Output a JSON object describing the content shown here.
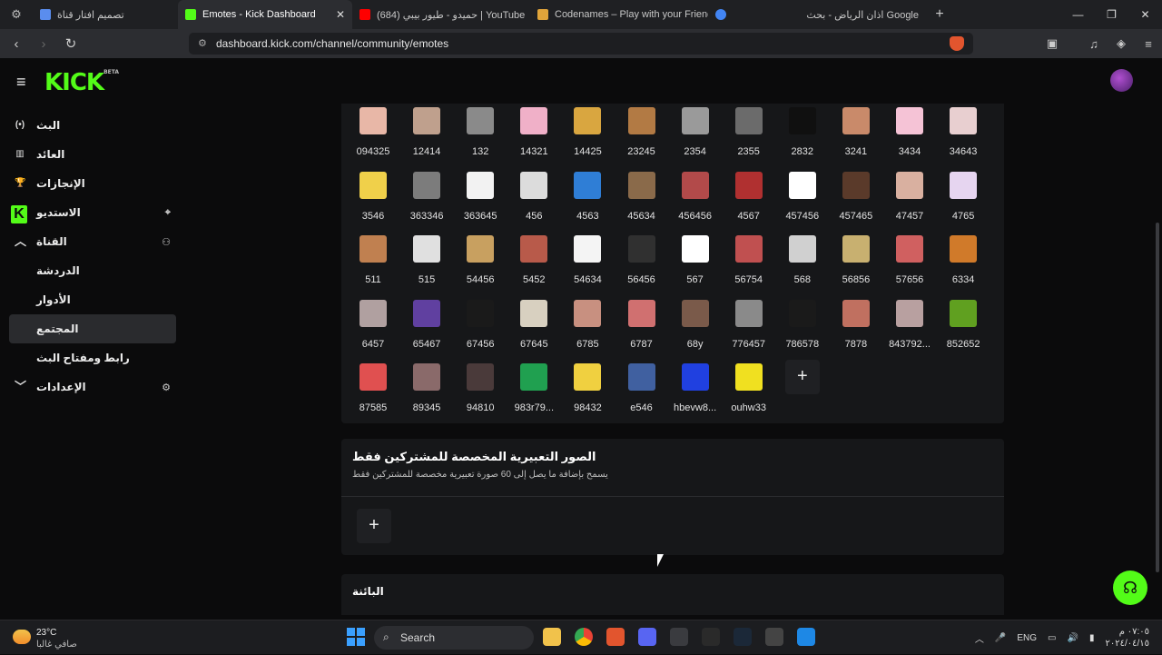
{
  "browser": {
    "tabs": [
      {
        "title": "تصميم افتار قناة",
        "color": "#5a8dee"
      },
      {
        "title": "Emotes - Kick Dashboard",
        "color": "#53fc18",
        "active": true
      },
      {
        "title": "حميدو - طيور بيبي (684) | YouTube",
        "color": "#ff0000"
      },
      {
        "title": "Codenames – Play with your Friends",
        "color": "#e0a43a"
      },
      {
        "title": "",
        "color": "#4285f4"
      },
      {
        "title": "اذان الرياض - بحث Google",
        "color": "#4285f4"
      }
    ],
    "url": "dashboard.kick.com/channel/community/emotes"
  },
  "app": {
    "logo": "KICK",
    "logo_badge": "BETA"
  },
  "sidebar": {
    "items": [
      {
        "label": "البث",
        "icon": "broadcast-icon"
      },
      {
        "label": "العائد",
        "icon": "chart-icon"
      },
      {
        "label": "الإنجازات",
        "icon": "trophy-icon"
      },
      {
        "label": "الاستديو",
        "icon": "studio-icon"
      },
      {
        "label": "القناة",
        "icon": "channel-icon"
      },
      {
        "label": "الدردشة"
      },
      {
        "label": "الأدوار"
      },
      {
        "label": "المجتمع"
      },
      {
        "label": "رابط ومفتاح البث"
      },
      {
        "label": "الإعدادات",
        "icon": "settings-icon"
      }
    ]
  },
  "emotes": {
    "row1": [
      "094325",
      "12414",
      "132",
      "14321",
      "14425",
      "23245",
      "2354",
      "2355",
      "2832",
      "3241",
      "3434",
      "34643"
    ],
    "row2": [
      "3546",
      "363346",
      "363645",
      "456",
      "4563",
      "45634",
      "456456",
      "4567",
      "457456",
      "457465",
      "47457",
      "4765"
    ],
    "row3": [
      "511",
      "515",
      "54456",
      "5452",
      "54634",
      "56456",
      "567",
      "56754",
      "568",
      "56856",
      "57656",
      "6334"
    ],
    "row4": [
      "6457",
      "65467",
      "67456",
      "67645",
      "6785",
      "6787",
      "68y",
      "776457",
      "786578",
      "7878",
      "843792...",
      "852652"
    ],
    "row5": [
      "87585",
      "89345",
      "94810",
      "983r79...",
      "98432",
      "e546",
      "hbevw8...",
      "ouhw33"
    ],
    "thumb_colors": [
      "#e8b7a7",
      "#bfa08d",
      "#8a8a8a",
      "#f0b0c8",
      "#d9a640",
      "#b27a44",
      "#9a9a9a",
      "#6b6b6b",
      "#101010",
      "#c98a6a",
      "#f5c3d6",
      "#e8cfd0",
      "#f0d04a",
      "#7c7c7c",
      "#f2f2f2",
      "#dcdcdc",
      "#2f7ed6",
      "#8a6a4a",
      "#b24a4a",
      "#b03030",
      "#ffffff",
      "#5a3a2a",
      "#d9b0a0",
      "#e6d5f0",
      "#c08050",
      "#e0e0e0",
      "#c8a060",
      "#b85a4a",
      "#f4f4f4",
      "#303030",
      "#ffffff",
      "#c05050",
      "#d0d0d0",
      "#c8b070",
      "#d06060",
      "#d07a2a",
      "#b0a0a0",
      "#6040a0",
      "#1a1a1a",
      "#d8d0c0",
      "#c89080",
      "#d07070",
      "#7a5a4a",
      "#8a8a8a",
      "#1a1a1a",
      "#c07060",
      "#b8a0a0",
      "#60a020",
      "#e05050",
      "#8a6a6a",
      "#4a3a3a",
      "#20a050",
      "#f0d040",
      "#4060a0",
      "#2040e0",
      "#f0e020"
    ]
  },
  "subscribers_section": {
    "title": "الصور التعبيرية المخصصة للمشتركين فقط",
    "description": "يسمح بإضافة ما يصل إلى 60 صورة تعبيرية مخصصة للمشتركين فقط"
  },
  "next_section": {
    "title": "البائنة"
  },
  "taskbar": {
    "temperature": "23°C",
    "weather": "صافي غالبا",
    "search_placeholder": "Search",
    "language": "ENG",
    "time": "٠٧:٠٥ م",
    "date": "٢٠٢٤/٠٤/١٥"
  }
}
